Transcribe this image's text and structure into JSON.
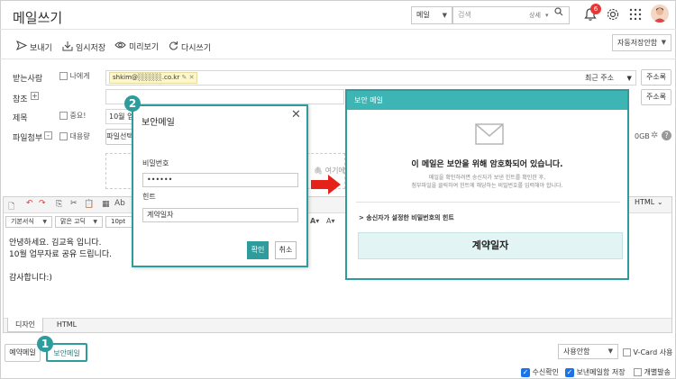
{
  "app": {
    "title": "메일쓰기"
  },
  "header": {
    "search_scope": "메일",
    "search_placeholder": "검색",
    "search_detail": "상세",
    "notification_count": "6"
  },
  "toolbar": {
    "send": "보내기",
    "draft": "임시저장",
    "preview": "미리보기",
    "rewrite": "다시쓰기",
    "autosave": "자동저장안함"
  },
  "form": {
    "to_label": "받는사람",
    "to_me": "나에게",
    "recipient_chip": "shkim@░░░░░.co.kr",
    "recent_address": "최근 주소",
    "address_book": "주소록",
    "cc_label": "참조",
    "cc_plus": "+",
    "subject_label": "제목",
    "important": "중요!",
    "subject_value": "10월 업",
    "attach_label": "파일첨부",
    "attach_minus": "-",
    "large_file": "대용량",
    "file_select": "파일선택",
    "storage_info": "0GB",
    "drop_hint": "여기에"
  },
  "editor": {
    "font_style": "기본서식",
    "font_family": "맑은 고딕",
    "font_size": "10pt",
    "html_toggle": "HTML",
    "body_lines": [
      "안녕하세요. 김교육 입니다.",
      "10월 업무자료 공유 드립니다.",
      "",
      "감사합니다:)"
    ],
    "tab_design": "디자인",
    "tab_html": "HTML"
  },
  "footer": {
    "scheduled": "예약메일",
    "secure": "보안메일",
    "usage": "사용안함",
    "vcard": "V-Card 사용",
    "read_receipt": "수신확인",
    "save_sent": "보낸메일함 저장",
    "individual": "개별발송"
  },
  "modal": {
    "title": "보안메일",
    "password_label": "비밀번호",
    "password_value": "••••••",
    "hint_label": "힌트",
    "hint_value": "계약일자",
    "confirm": "확인",
    "cancel": "취소"
  },
  "preview": {
    "header": "보안 메일",
    "heading": "이 메일은 보안을 위해 암호화되어 있습니다.",
    "desc1": "메일을 확인하려면 송신자가 보낸 힌트를 확인한 후,",
    "desc2": "첨부파일을 클릭하여 힌트에 해당하는 비밀번호를 입력해야 합니다.",
    "hint_title": "> 송신자가 설정한 비밀번호의 힌트",
    "hint_value": "계약일자"
  },
  "markers": {
    "step1": "1",
    "step2": "2"
  },
  "colors": {
    "accent": "#2e9c9c",
    "notification": "#e53935",
    "arrow": "#e5221a",
    "checkbox": "#1a73e8"
  }
}
